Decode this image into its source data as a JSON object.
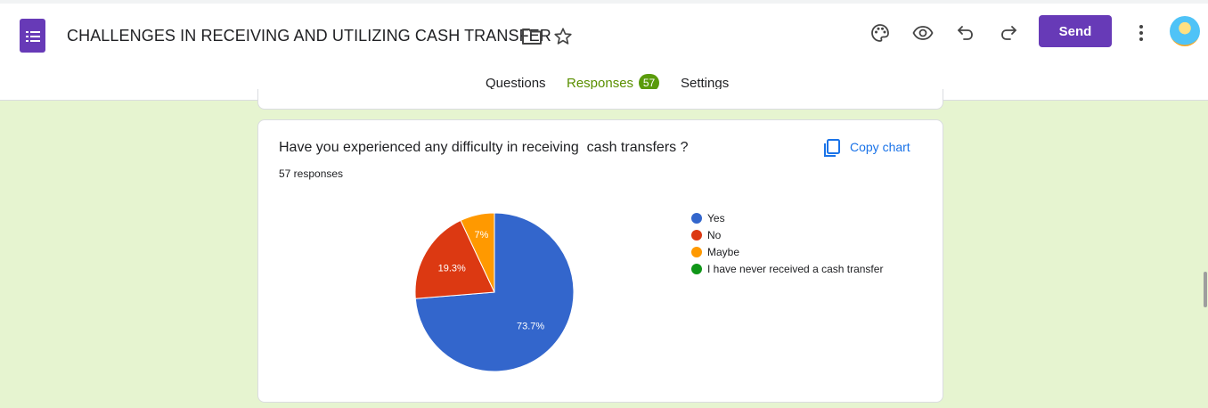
{
  "header": {
    "title": "CHALLENGES IN RECEIVING AND UTILIZING CASH TRANSFER",
    "send_label": "Send",
    "icons": [
      "forms-app-icon",
      "folder-icon",
      "star-icon",
      "palette-icon",
      "preview-eye-icon",
      "undo-icon",
      "redo-icon",
      "more-vert-icon",
      "avatar"
    ]
  },
  "tabs": {
    "questions": "Questions",
    "responses": "Responses",
    "responses_count": "57",
    "settings": "Settings"
  },
  "card": {
    "question": "Have you experienced any difficulty in receiving  cash transfers ?",
    "count_text": "57 responses",
    "copy_label": "Copy chart"
  },
  "colors": {
    "accent": "#673ab7",
    "tab_active": "#5a8f00",
    "background": "#e6f4d0",
    "link": "#1a73e8"
  },
  "chart_data": {
    "type": "pie",
    "categories": [
      "Yes",
      "No",
      "Maybe",
      "I have never received a cash transfer"
    ],
    "values": [
      73.7,
      19.3,
      7,
      0
    ],
    "labels": [
      "73.7%",
      "19.3%",
      "7%",
      ""
    ],
    "colors": [
      "#3366cc",
      "#dc3912",
      "#ff9900",
      "#109618"
    ],
    "legend": "right"
  }
}
